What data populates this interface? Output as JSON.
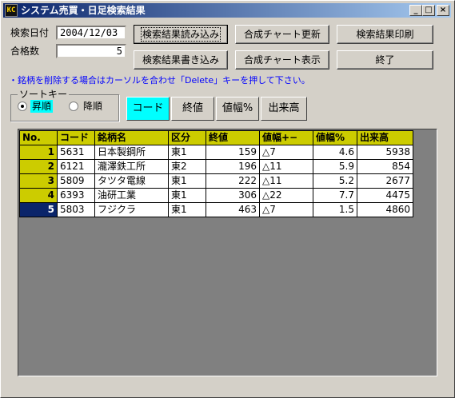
{
  "window": {
    "title": "システム売買・日足検索結果",
    "icon_glyph": "KC",
    "minimize_glyph": "_",
    "maximize_glyph": "□",
    "close_glyph": "×"
  },
  "search": {
    "date_label": "検索日付",
    "date_value": "2004/12/03",
    "count_label": "合格数",
    "count_value": "5"
  },
  "buttons": {
    "load": "検索結果読み込み",
    "write": "検索結果書き込み",
    "chart_update": "合成チャート更新",
    "chart_show": "合成チャート表示",
    "print": "検索結果印刷",
    "exit": "終了"
  },
  "hint": "・銘柄を削除する場合はカーソルを合わせ「Delete」キーを押して下さい。",
  "sort": {
    "group_title": "ソートキー",
    "asc_label": "昇順",
    "desc_label": "降順",
    "selected": "asc",
    "keys": [
      "コード",
      "終値",
      "値幅%",
      "出来高"
    ],
    "active_key": "コード",
    "active_color": "#00ffff"
  },
  "table": {
    "columns": [
      "No.",
      "コード",
      "銘柄名",
      "区分",
      "終値",
      "値幅+−",
      "値幅%",
      "出来高"
    ],
    "rows": [
      {
        "no": "1",
        "code": "5631",
        "name": "日本製鋼所",
        "market": "東1",
        "close": "159",
        "change": "△7",
        "pct": "4.6",
        "volume": "5938"
      },
      {
        "no": "2",
        "code": "6121",
        "name": "瀧澤鉄工所",
        "market": "東2",
        "close": "196",
        "change": "△11",
        "pct": "5.9",
        "volume": "854"
      },
      {
        "no": "3",
        "code": "5809",
        "name": "タツタ電線",
        "market": "東1",
        "close": "222",
        "change": "△11",
        "pct": "5.2",
        "volume": "2677"
      },
      {
        "no": "4",
        "code": "6393",
        "name": "油研工業",
        "market": "東1",
        "close": "306",
        "change": "△22",
        "pct": "7.7",
        "volume": "4475"
      },
      {
        "no": "5",
        "code": "5803",
        "name": "フジクラ",
        "market": "東1",
        "close": "463",
        "change": "△7",
        "pct": "1.5",
        "volume": "4860"
      }
    ],
    "selected_row": "5",
    "header_color": "#cccc00",
    "selected_color": "#0a246a"
  }
}
